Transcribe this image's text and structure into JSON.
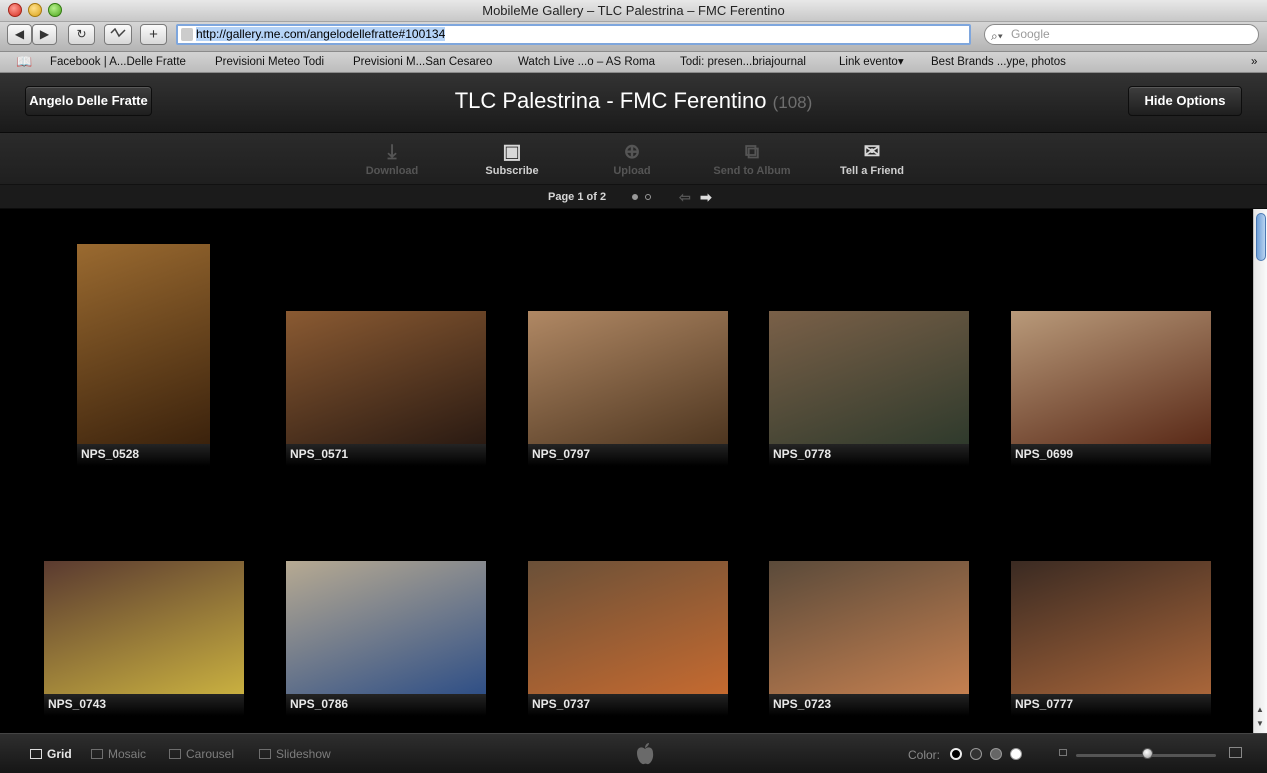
{
  "window": {
    "title": "MobileMe Gallery – TLC Palestrina – FMC Ferentino"
  },
  "toolbar": {
    "back": "◀",
    "forward": "▶",
    "reload": "↻",
    "add": "+",
    "url": "http://gallery.me.com/angelodellefratte#100134",
    "search_placeholder": "Google"
  },
  "bookmarks": [
    "Facebook | A...Delle Fratte",
    "Previsioni Meteo Todi",
    "Previsioni M...San Cesareo",
    "Watch Live ...o – AS Roma",
    "Todi: presen...briajournal",
    "Link  evento▾",
    "Best Brands ...ype, photos"
  ],
  "header": {
    "owner_button": "Angelo Delle Fratte",
    "album_title": "TLC Palestrina - FMC Ferentino",
    "photo_count": "(108)",
    "options_button": "Hide Options"
  },
  "actions": [
    {
      "label": "Download",
      "enabled": false,
      "icon": "download-icon"
    },
    {
      "label": "Subscribe",
      "enabled": true,
      "icon": "subscribe-icon"
    },
    {
      "label": "Upload",
      "enabled": false,
      "icon": "upload-icon"
    },
    {
      "label": "Send to Album",
      "enabled": false,
      "icon": "send-icon"
    },
    {
      "label": "Tell a Friend",
      "enabled": true,
      "icon": "mail-icon"
    }
  ],
  "pager": {
    "text": "Page 1 of 2"
  },
  "photos": [
    {
      "name": "NPS_0528",
      "colors": [
        "#9a6a30",
        "#3b220c"
      ]
    },
    {
      "name": "NPS_0571",
      "colors": [
        "#8a5a32",
        "#2a1a12"
      ]
    },
    {
      "name": "NPS_0797",
      "colors": [
        "#b08864",
        "#4e3620"
      ]
    },
    {
      "name": "NPS_0778",
      "colors": [
        "#7a6048",
        "#2f3a2c"
      ]
    },
    {
      "name": "NPS_0699",
      "colors": [
        "#b99a7a",
        "#5a2a18"
      ]
    },
    {
      "name": "NPS_0743",
      "colors": [
        "#5a3a30",
        "#c9b040"
      ]
    },
    {
      "name": "NPS_0786",
      "colors": [
        "#b7aa92",
        "#2f4f86"
      ]
    },
    {
      "name": "NPS_0737",
      "colors": [
        "#6a5038",
        "#c56a30"
      ]
    },
    {
      "name": "NPS_0723",
      "colors": [
        "#5a4a3a",
        "#c58050"
      ]
    },
    {
      "name": "NPS_0777",
      "colors": [
        "#3a2a22",
        "#a9663a"
      ]
    }
  ],
  "bottom": {
    "views": [
      "Grid",
      "Mosaic",
      "Carousel",
      "Slideshow"
    ],
    "active_view": "Grid",
    "color_label": "Color:",
    "swatches": [
      "#000000",
      "#333333",
      "#666666",
      "#ffffff"
    ]
  }
}
